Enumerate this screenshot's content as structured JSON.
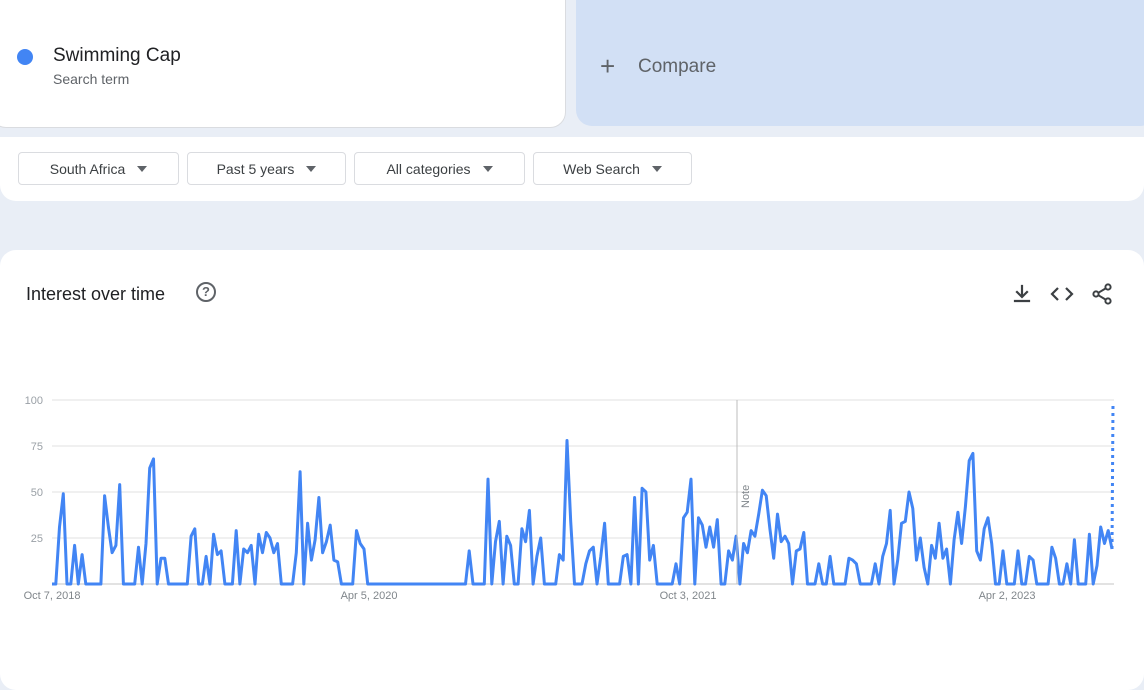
{
  "search_term": {
    "name": "Swimming Cap",
    "subtitle": "Search term",
    "color": "#4285f4"
  },
  "compare": {
    "label": "Compare",
    "icon": "plus-icon"
  },
  "filters": [
    {
      "label": "South Africa",
      "icon": "caret-down-icon"
    },
    {
      "label": "Past 5 years",
      "icon": "caret-down-icon"
    },
    {
      "label": "All categories",
      "icon": "caret-down-icon"
    },
    {
      "label": "Web Search",
      "icon": "caret-down-icon"
    }
  ],
  "interest_panel": {
    "title": "Interest over time",
    "icons": [
      "help-icon",
      "download-icon",
      "embed-code-icon",
      "share-icon"
    ],
    "note_label": "Note"
  },
  "chart_data": {
    "type": "line",
    "ylim": [
      0,
      100
    ],
    "y_ticks": [
      "100",
      "75",
      "50",
      "25"
    ],
    "x_ticks": [
      "Oct 7, 2018",
      "Apr 5, 2020",
      "Oct 3, 2021",
      "Apr 2, 2023"
    ],
    "grid": true,
    "series": [
      {
        "color": "#4285f4",
        "values": [
          0,
          0,
          31,
          49,
          0,
          0,
          21,
          0,
          16,
          0,
          0,
          0,
          0,
          0,
          48,
          31,
          17,
          21,
          54,
          0,
          0,
          0,
          0,
          20,
          0,
          22,
          63,
          68,
          0,
          14,
          14,
          0,
          0,
          0,
          0,
          0,
          0,
          26,
          30,
          0,
          0,
          15,
          0,
          27,
          16,
          18,
          0,
          0,
          0,
          29,
          0,
          19,
          17,
          21,
          0,
          27,
          17,
          28,
          25,
          17,
          22,
          0,
          0,
          0,
          0,
          17,
          61,
          0,
          33,
          13,
          24,
          47,
          17,
          23,
          32,
          13,
          12,
          0,
          0,
          0,
          0,
          29,
          22,
          19,
          0,
          0,
          0,
          0,
          0,
          0,
          0,
          0,
          0,
          0,
          0,
          0,
          0,
          0,
          0,
          0,
          0,
          0,
          0,
          0,
          0,
          0,
          0,
          0,
          0,
          0,
          0,
          18,
          0,
          0,
          0,
          0,
          57,
          0,
          23,
          34,
          0,
          26,
          21,
          0,
          0,
          30,
          23,
          40,
          0,
          15,
          25,
          0,
          0,
          0,
          0,
          16,
          13,
          78,
          34,
          0,
          0,
          0,
          11,
          18,
          20,
          0,
          15,
          33,
          0,
          0,
          0,
          0,
          15,
          16,
          0,
          47,
          0,
          52,
          50,
          13,
          21,
          0,
          0,
          0,
          0,
          0,
          11,
          0,
          36,
          39,
          57,
          0,
          36,
          32,
          20,
          31,
          20,
          35,
          0,
          0,
          18,
          13,
          26,
          0,
          22,
          17,
          29,
          26,
          38,
          51,
          48,
          30,
          14,
          38,
          23,
          26,
          22,
          0,
          18,
          19,
          28,
          0,
          0,
          0,
          11,
          0,
          0,
          15,
          0,
          0,
          0,
          0,
          14,
          13,
          11,
          0,
          0,
          0,
          0,
          11,
          0,
          15,
          22,
          40,
          0,
          13,
          33,
          34,
          50,
          41,
          13,
          25,
          9,
          0,
          21,
          14,
          33,
          14,
          19,
          0,
          24,
          39,
          22,
          42,
          67,
          71,
          18,
          13,
          30,
          36,
          22,
          0,
          0,
          18,
          0,
          0,
          0,
          18,
          0,
          0,
          15,
          13,
          0,
          0,
          0,
          0,
          20,
          14,
          0,
          0,
          11,
          0,
          24,
          0,
          0,
          0,
          27,
          0,
          10,
          31,
          22,
          29,
          19
        ],
        "partial_last_value": 98
      }
    ]
  }
}
